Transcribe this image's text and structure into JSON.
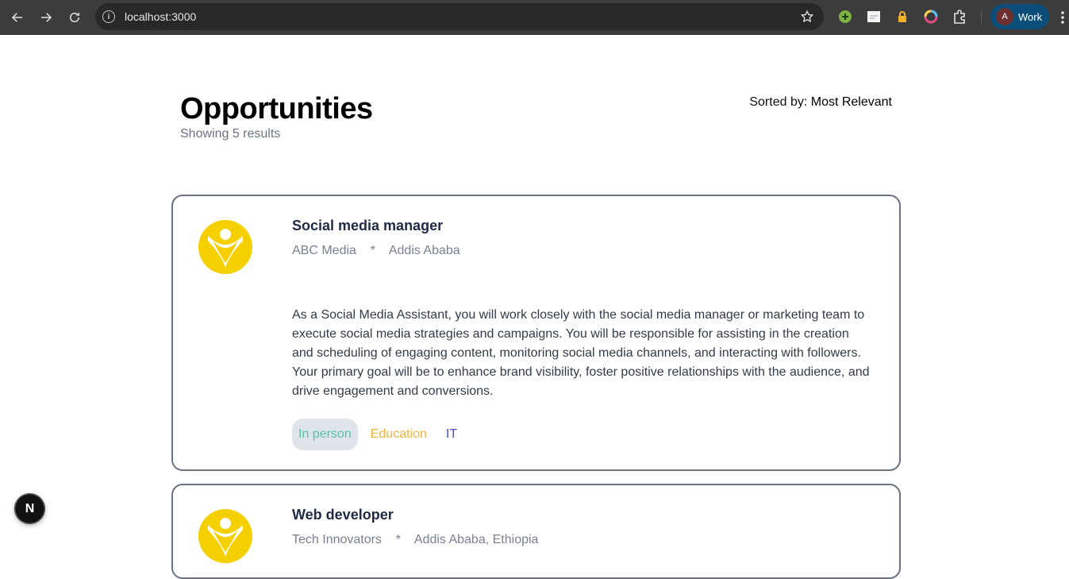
{
  "browser": {
    "url": "localhost:3000",
    "profile_initial": "A",
    "profile_name": "Work"
  },
  "page": {
    "title": "Opportunities",
    "results": "Showing 5 results",
    "sort_prefix": "Sorted by: ",
    "sort_value": "Most Relevant"
  },
  "opportunities": [
    {
      "title": "Social media manager",
      "company": "ABC Media",
      "separator": "*",
      "location": "Addis Ababa",
      "description": "As a Social Media Assistant, you will work closely with the social media manager or marketing team to execute social media strategies and campaigns. You will be responsible for assisting in the creation and scheduling of engaging content, monitoring social media channels, and interacting with followers. Your primary goal will be to enhance brand visibility, foster positive relationships with the audience, and drive engagement and conversions.",
      "tags": [
        "In person",
        "Education",
        "IT"
      ]
    },
    {
      "title": "Web developer",
      "company": "Tech Innovators",
      "separator": "*",
      "location": "Addis Ababa, Ethiopia"
    }
  ],
  "dev_badge": "N",
  "colors": {
    "tag_in_person": "#56c2a3",
    "tag_education": "#f2b33d",
    "tag_it": "#4b4fc9",
    "logo_yellow": "#f5d000"
  }
}
